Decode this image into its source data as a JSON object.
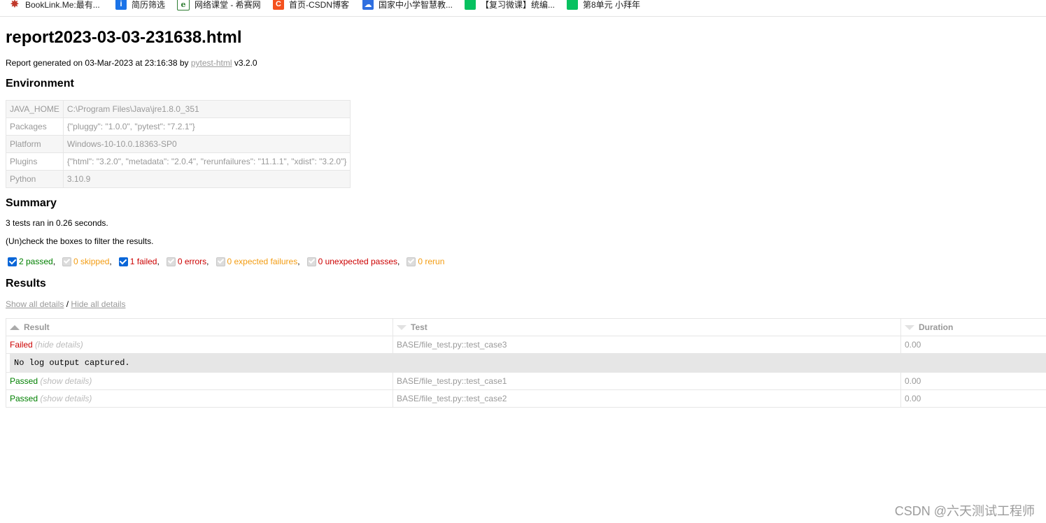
{
  "bookmarks": [
    {
      "label": "BookLink.Me:最有...",
      "icon": "star-icon"
    },
    {
      "label": "简历筛选",
      "icon": "info-icon"
    },
    {
      "label": "网络课堂 - 希赛网",
      "icon": "e-icon"
    },
    {
      "label": "首页-CSDN博客",
      "icon": "csdn-icon"
    },
    {
      "label": "国家中小学智慧教...",
      "icon": "cloud-icon"
    },
    {
      "label": "【复习微课】统编...",
      "icon": "wechat-icon"
    },
    {
      "label": "第8单元 小拜年",
      "icon": "wechat-icon"
    }
  ],
  "report": {
    "title": "report2023-03-03-231638.html",
    "generated_prefix": "Report generated on 03-Mar-2023 at 23:16:38 by",
    "generated_link": "pytest-html",
    "generated_suffix": "v3.2.0"
  },
  "environment": {
    "heading": "Environment",
    "rows": [
      {
        "key": "JAVA_HOME",
        "value": "C:\\Program Files\\Java\\jre1.8.0_351"
      },
      {
        "key": "Packages",
        "value": "{\"pluggy\": \"1.0.0\", \"pytest\": \"7.2.1\"}"
      },
      {
        "key": "Platform",
        "value": "Windows-10-10.0.18363-SP0"
      },
      {
        "key": "Plugins",
        "value": "{\"html\": \"3.2.0\", \"metadata\": \"2.0.4\", \"rerunfailures\": \"11.1.1\", \"xdist\": \"3.2.0\"}"
      },
      {
        "key": "Python",
        "value": "3.10.9"
      }
    ]
  },
  "summary": {
    "heading": "Summary",
    "ran_text": "3 tests ran in 0.26 seconds.",
    "filter_hint": "(Un)check the boxes to filter the results.",
    "filters": [
      {
        "label": "2 passed",
        "checked": true
      },
      {
        "label": "0 skipped",
        "checked": false
      },
      {
        "label": "1 failed",
        "checked": true
      },
      {
        "label": "0 errors",
        "checked": false
      },
      {
        "label": "0 expected failures",
        "checked": false
      },
      {
        "label": "0 unexpected passes",
        "checked": false
      },
      {
        "label": "0 rerun",
        "checked": false
      }
    ]
  },
  "results": {
    "heading": "Results",
    "show_all": "Show all details",
    "separator": "/",
    "hide_all": "Hide all details",
    "columns": {
      "result": "Result",
      "test": "Test",
      "duration": "Duration"
    },
    "rows": [
      {
        "result": "Failed",
        "toggle": "(hide details)",
        "test": "BASE/file_test.py::test_case3",
        "duration": "0.00"
      },
      {
        "result": "Passed",
        "toggle": "(show details)",
        "test": "BASE/file_test.py::test_case1",
        "duration": "0.00"
      },
      {
        "result": "Passed",
        "toggle": "(show details)",
        "test": "BASE/file_test.py::test_case2",
        "duration": "0.00"
      }
    ],
    "log_text": "No log output captured."
  },
  "watermark": "CSDN @六天测试工程师"
}
